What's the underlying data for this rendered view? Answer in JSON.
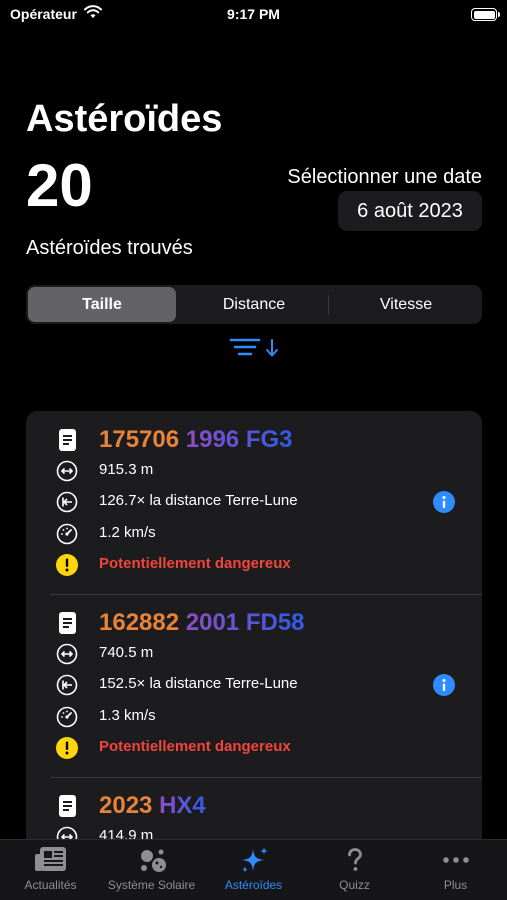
{
  "status_bar": {
    "carrier": "Opérateur",
    "time": "9:17 PM"
  },
  "header": {
    "title": "Astéroïdes",
    "count": "20",
    "count_label": "Astéroïdes trouvés",
    "date_label": "Sélectionner une date",
    "date_value": "6 août 2023"
  },
  "sort_segments": [
    {
      "label": "Taille",
      "selected": true
    },
    {
      "label": "Distance",
      "selected": false
    },
    {
      "label": "Vitesse",
      "selected": false
    }
  ],
  "asteroids": [
    {
      "number": "175706",
      "designation": "1996 FG3",
      "diameter": "915.3 m",
      "distance": "126.7× la distance Terre-Lune",
      "speed": "1.2 km/s",
      "hazard": "Potentiellement dangereux"
    },
    {
      "number": "162882",
      "designation": "2001 FD58",
      "diameter": "740.5 m",
      "distance": "152.5× la distance Terre-Lune",
      "speed": "1.3 km/s",
      "hazard": "Potentiellement dangereux"
    },
    {
      "number": "2023",
      "designation": "HX4",
      "diameter": "414.9 m"
    }
  ],
  "tab_bar": {
    "tabs": [
      {
        "label": "Actualités",
        "icon": "newspaper-icon",
        "active": false
      },
      {
        "label": "Système Solaire",
        "icon": "planets-icon",
        "active": false
      },
      {
        "label": "Astéroïdes",
        "icon": "sparkles-icon",
        "active": true
      },
      {
        "label": "Quizz",
        "icon": "question-icon",
        "active": false
      },
      {
        "label": "Plus",
        "icon": "ellipsis-icon",
        "active": false
      }
    ]
  },
  "colors": {
    "accent": "#2f8cff",
    "danger": "#f2453d",
    "warning": "#ffd60a",
    "number_orange": "#e8833a",
    "gradient_purple": "#8e4ec6",
    "gradient_blue": "#2f5bea"
  }
}
